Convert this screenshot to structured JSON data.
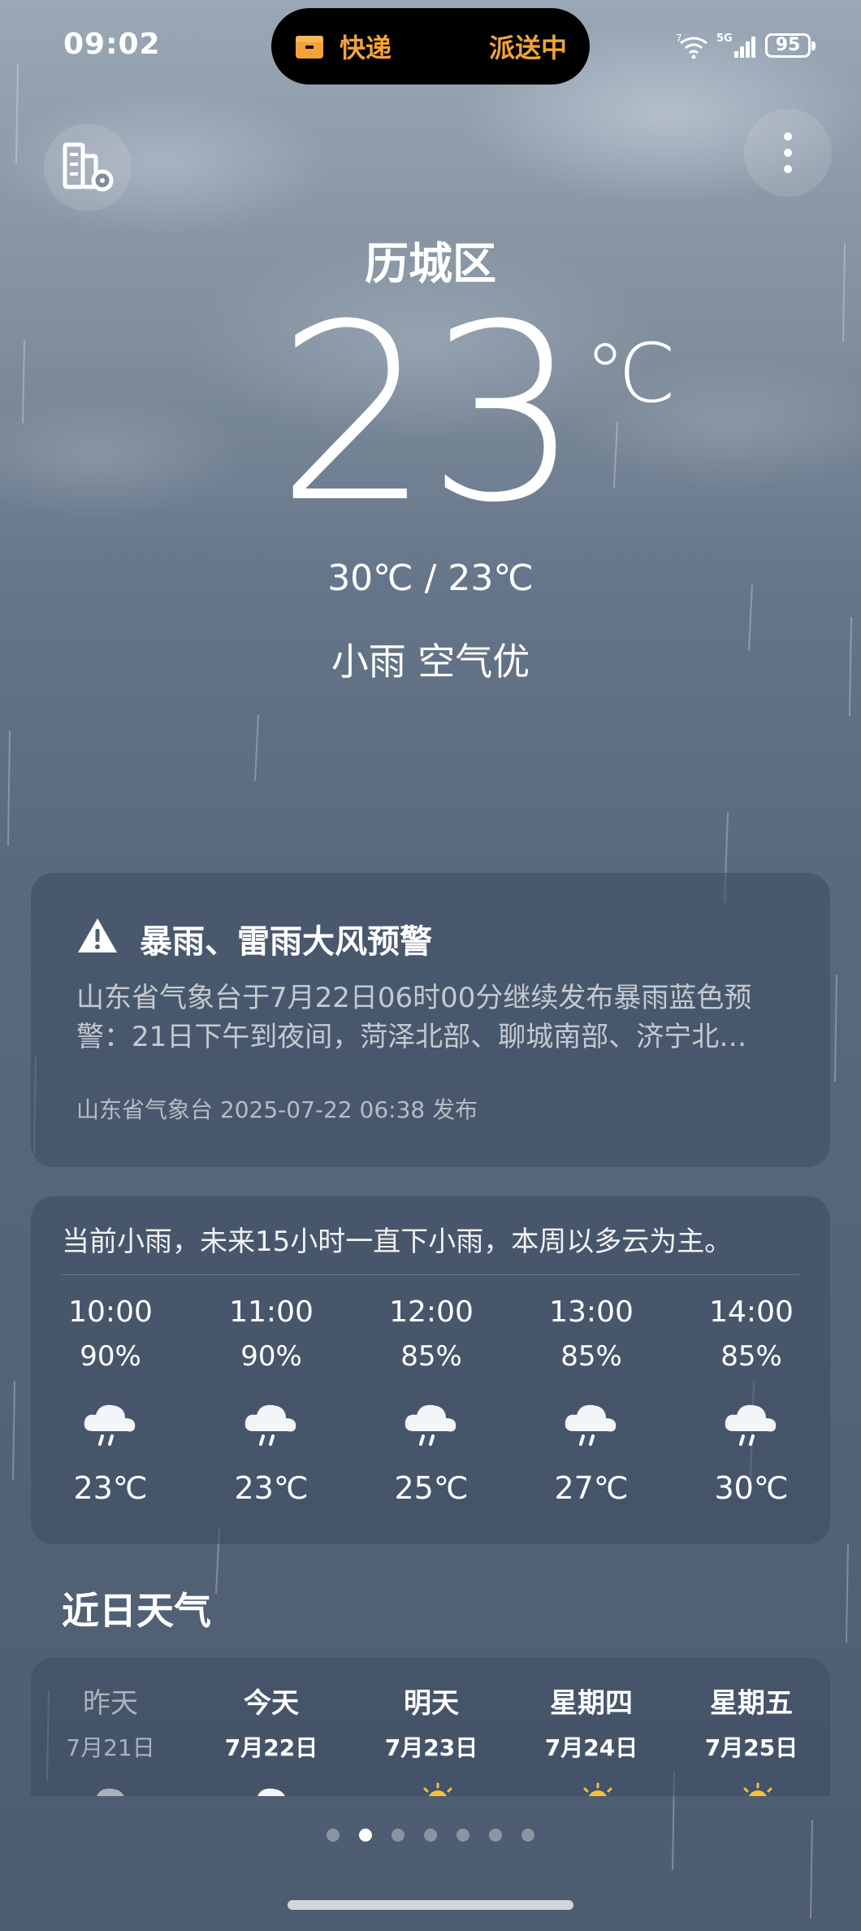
{
  "status_bar": {
    "time": "09:02",
    "island_left": "快递",
    "island_right": "派送中",
    "signal_label": "5G",
    "wifi_label": "7",
    "battery": "95"
  },
  "location": {
    "city": "历城区"
  },
  "current": {
    "temperature": "23",
    "unit": "℃",
    "range": "30℃ / 23℃",
    "condition": "小雨  空气优"
  },
  "alert": {
    "title": "暴雨、雷雨大风预警",
    "body": "山东省气象台于7月22日06时00分继续发布暴雨蓝色预警：21日下午到夜间，菏泽北部、聊城南部、济宁北…",
    "footer": "山东省气象台 2025-07-22 06:38 发布"
  },
  "hourly": {
    "summary": "当前小雨，未来15小时一直下小雨，本周以多云为主。",
    "items": [
      {
        "time": "10:00",
        "precip": "90%",
        "icon": "light-rain-icon",
        "temp": "23℃"
      },
      {
        "time": "11:00",
        "precip": "90%",
        "icon": "light-rain-icon",
        "temp": "23℃"
      },
      {
        "time": "12:00",
        "precip": "85%",
        "icon": "light-rain-icon",
        "temp": "25℃"
      },
      {
        "time": "13:00",
        "precip": "85%",
        "icon": "light-rain-icon",
        "temp": "27℃"
      },
      {
        "time": "14:00",
        "precip": "85%",
        "icon": "light-rain-icon",
        "temp": "30℃"
      }
    ]
  },
  "daily": {
    "title": "近日天气",
    "items": [
      {
        "name": "昨天",
        "date": "7月21日",
        "icon": "cloudy-icon"
      },
      {
        "name": "今天",
        "date": "7月22日",
        "icon": "cloudy-icon"
      },
      {
        "name": "明天",
        "date": "7月23日",
        "icon": "partly-sunny-icon"
      },
      {
        "name": "星期四",
        "date": "7月24日",
        "icon": "partly-sunny-icon"
      },
      {
        "name": "星期五",
        "date": "7月25日",
        "icon": "partly-sunny-icon"
      }
    ]
  },
  "pager": {
    "count": 7,
    "active_index": 1
  },
  "colors": {
    "island_accent": "#f2a33a",
    "sun": "#f6c23a"
  }
}
